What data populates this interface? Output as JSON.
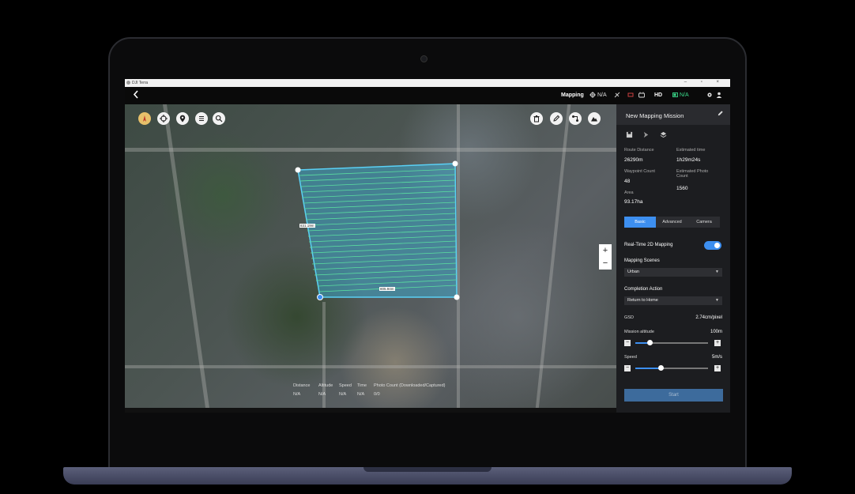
{
  "window": {
    "app_name": "DJI Terra",
    "controls": "–  ▫  ×"
  },
  "topbar": {
    "back_icon": "chevron-left-icon",
    "mode": "Mapping",
    "gps_status": "N/A",
    "hd_label": "HD",
    "battery_status": "N/A",
    "colors": {
      "battery": "#39d98a"
    }
  },
  "map": {
    "tools_left": [
      "compass-icon",
      "target-icon",
      "location-pin-icon",
      "list-icon",
      "search-icon"
    ],
    "tools_right": [
      "trash-icon",
      "edit-icon",
      "route-icon",
      "terrain-icon"
    ],
    "edge_labels": [
      "831.19m",
      "805.94m"
    ],
    "zoom_in": "+",
    "zoom_out": "−",
    "stats": {
      "headers": [
        "Distance",
        "Altitude",
        "Speed",
        "Time",
        "Photo Count (Downloaded/Captured)"
      ],
      "values": [
        "N/A",
        "N/A",
        "N/A",
        "N/A",
        "0/0"
      ]
    },
    "colors": {
      "survey_area": "#39b6e0"
    }
  },
  "panel": {
    "title": "New Mapping Mission",
    "icons": [
      "save-icon",
      "send-icon",
      "layers-icon"
    ],
    "route_distance_label": "Route Distance",
    "route_distance": "26290m",
    "estimated_time_label": "Estimated time",
    "estimated_time": "1h29m24s",
    "waypoint_count_label": "Waypoint Count",
    "waypoint_count": "48",
    "estimated_photo_label": "Estimated Photo Count",
    "estimated_photo": "1560",
    "area_label": "Area",
    "area": "93.17ha",
    "tabs": [
      "Basic",
      "Advanced",
      "Camera"
    ],
    "realtime_label": "Real-Time 2D Mapping",
    "realtime_enabled": true,
    "scenes_label": "Mapping Scenes",
    "scenes_value": "Urban",
    "completion_label": "Completion Action",
    "completion_value": "Return to Home",
    "gsd_label": "GSD",
    "gsd_value": "2.74cm/pixel",
    "altitude_label": "Mission altitude",
    "altitude_value": "100m",
    "altitude_level": 0.2,
    "speed_label": "Speed",
    "speed_value": "5m/s",
    "speed_level": 0.35,
    "minus": "−",
    "plus": "+",
    "start_label": "Start",
    "colors": {
      "accent": "#3d8ff0"
    }
  }
}
